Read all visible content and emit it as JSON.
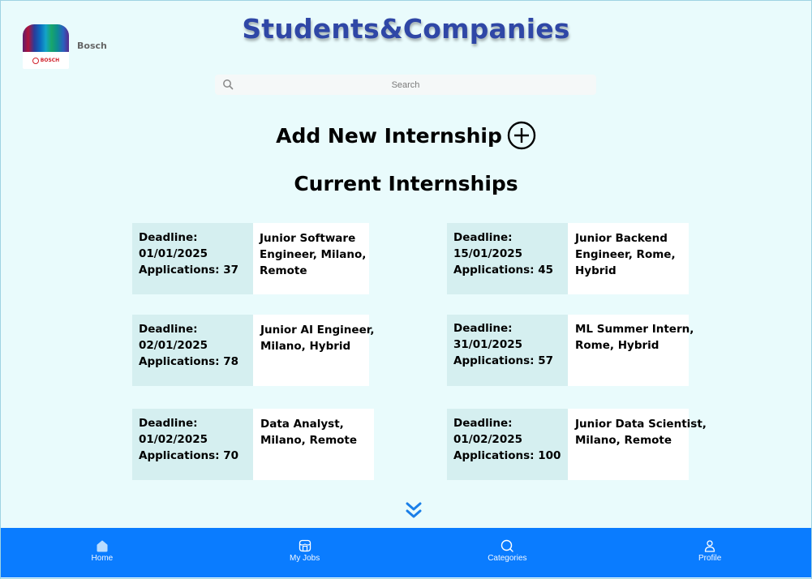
{
  "app": {
    "title": "Students&Companies"
  },
  "company": {
    "name": "Bosch",
    "logo_text": "BOSCH"
  },
  "search": {
    "placeholder": "Search",
    "value": ""
  },
  "add_internship": {
    "label": "Add New Internship",
    "icon": "plus-circle-icon"
  },
  "section": {
    "title": "Current Internships"
  },
  "internships": [
    {
      "deadline": "Deadline:",
      "date": "01/01/2025",
      "applications": "Applications: 37",
      "title_lines": [
        "Junior Software",
        "Engineer, Milano,",
        "Remote"
      ]
    },
    {
      "deadline": "Deadline:",
      "date": "15/01/2025",
      "applications": "Applications: 45",
      "title_lines": [
        "Junior Backend",
        "Engineer, Rome,",
        "Hybrid"
      ]
    },
    {
      "deadline": "Deadline:",
      "date": "02/01/2025",
      "applications": "Applications: 78",
      "title_lines": [
        "Junior AI Engineer,",
        "Milano, Hybrid"
      ]
    },
    {
      "deadline": "Deadline:",
      "date": "31/01/2025",
      "applications": "Applications: 57",
      "title_lines": [
        "ML Summer Intern,",
        "Rome, Hybrid"
      ]
    },
    {
      "deadline": "Deadline:",
      "date": "01/02/2025",
      "applications": "Applications: 70",
      "title_lines": [
        "Data Analyst,",
        "Milano, Remote"
      ]
    },
    {
      "deadline": "Deadline:",
      "date": "01/02/2025",
      "applications": "Applications: 100",
      "title_lines": [
        "Junior Data Scientist,",
        "Milano, Remote"
      ]
    }
  ],
  "nav": {
    "items": [
      {
        "label": "Home",
        "icon": "home-icon"
      },
      {
        "label": "My Jobs",
        "icon": "jobs-icon"
      },
      {
        "label": "Categories",
        "icon": "search-icon"
      },
      {
        "label": "Profile",
        "icon": "profile-icon"
      }
    ]
  },
  "colors": {
    "background": "#e9fbfc",
    "accent": "#0a7cff",
    "title": "#2f47a6",
    "card_meta": "#d5eff0"
  }
}
